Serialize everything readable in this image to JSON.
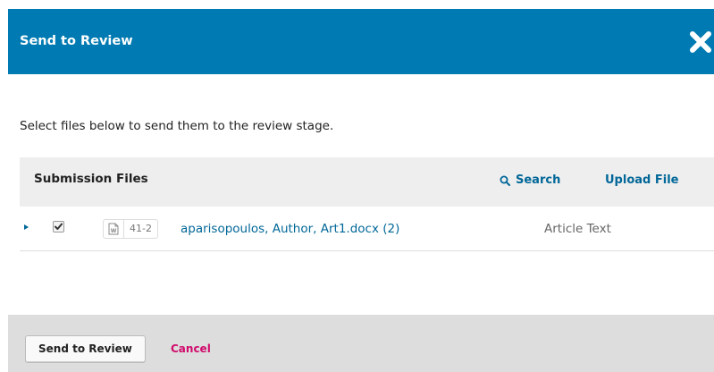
{
  "modal": {
    "title": "Send to Review",
    "close_icon": "close-icon",
    "header_color": "#007ab2"
  },
  "intro": "Select files below to send them to the review stage.",
  "grid": {
    "title": "Submission Files",
    "search_label": "Search",
    "upload_label": "Upload File",
    "link_color": "#006798",
    "rows": [
      {
        "checked": true,
        "file_type_icon": "word-document-icon",
        "id": "41-2",
        "name": "aparisopoulos, Author, Art1.docx (2)",
        "genre": "Article Text"
      }
    ]
  },
  "footer": {
    "submit_label": "Send to Review",
    "cancel_label": "Cancel",
    "cancel_color": "#d00a6c"
  }
}
